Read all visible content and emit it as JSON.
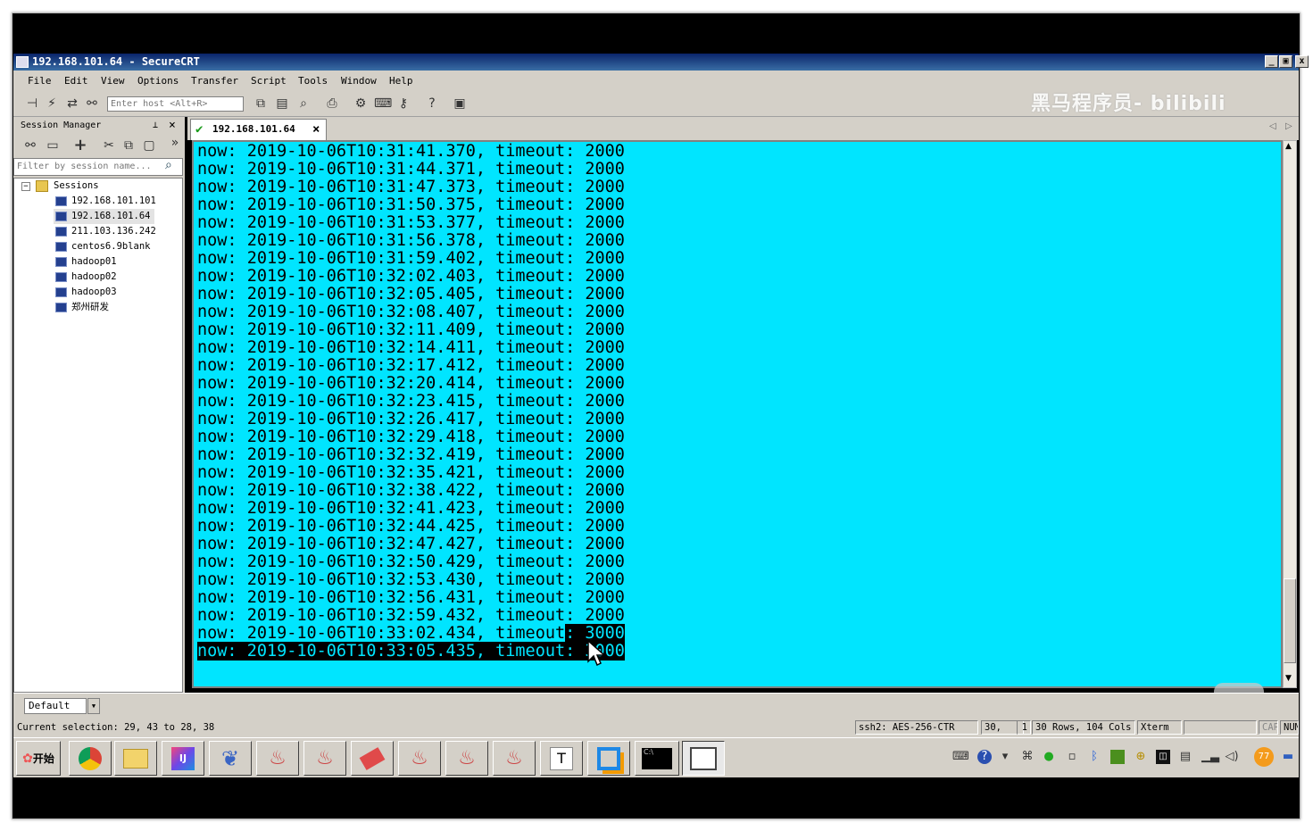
{
  "window": {
    "title": "192.168.101.64 - SecureCRT",
    "controls": [
      "_",
      "▣",
      "x"
    ]
  },
  "menu": [
    "File",
    "Edit",
    "View",
    "Options",
    "Transfer",
    "Script",
    "Tools",
    "Window",
    "Help"
  ],
  "toolbar": {
    "host_placeholder": "Enter host <Alt+R>",
    "watermark": "黑马程序员- bilibili"
  },
  "session_manager": {
    "title": "Session Manager",
    "filter_placeholder": "Filter by session name...",
    "root": "Sessions",
    "sessions": [
      "192.168.101.101",
      "192.168.101.64",
      "211.103.136.242",
      "centos6.9blank",
      "hadoop01",
      "hadoop02",
      "hadoop03",
      "郑州研发"
    ],
    "selected": "192.168.101.64"
  },
  "tab": {
    "label": "192.168.101.64",
    "status_icon": "check-icon"
  },
  "terminal": {
    "background": "#00e5ff",
    "lines": [
      "now: 2019-10-06T10:31:41.370, timeout: 2000",
      "now: 2019-10-06T10:31:44.371, timeout: 2000",
      "now: 2019-10-06T10:31:47.373, timeout: 2000",
      "now: 2019-10-06T10:31:50.375, timeout: 2000",
      "now: 2019-10-06T10:31:53.377, timeout: 2000",
      "now: 2019-10-06T10:31:56.378, timeout: 2000",
      "now: 2019-10-06T10:31:59.402, timeout: 2000",
      "now: 2019-10-06T10:32:02.403, timeout: 2000",
      "now: 2019-10-06T10:32:05.405, timeout: 2000",
      "now: 2019-10-06T10:32:08.407, timeout: 2000",
      "now: 2019-10-06T10:32:11.409, timeout: 2000",
      "now: 2019-10-06T10:32:14.411, timeout: 2000",
      "now: 2019-10-06T10:32:17.412, timeout: 2000",
      "now: 2019-10-06T10:32:20.414, timeout: 2000",
      "now: 2019-10-06T10:32:23.415, timeout: 2000",
      "now: 2019-10-06T10:32:26.417, timeout: 2000",
      "now: 2019-10-06T10:32:29.418, timeout: 2000",
      "now: 2019-10-06T10:32:32.419, timeout: 2000",
      "now: 2019-10-06T10:32:35.421, timeout: 2000",
      "now: 2019-10-06T10:32:38.422, timeout: 2000",
      "now: 2019-10-06T10:32:41.423, timeout: 2000",
      "now: 2019-10-06T10:32:44.425, timeout: 2000",
      "now: 2019-10-06T10:32:47.427, timeout: 2000",
      "now: 2019-10-06T10:32:50.429, timeout: 2000",
      "now: 2019-10-06T10:32:53.430, timeout: 2000",
      "now: 2019-10-06T10:32:56.431, timeout: 2000",
      "now: 2019-10-06T10:32:59.432, timeout: 2000",
      "now: 2019-10-06T10:33:02.434, timeout: 3000",
      "now: 2019-10-06T10:33:05.435, timeout: 3000"
    ]
  },
  "lower_bar": {
    "button_bar": "Default"
  },
  "status": {
    "selection": "Current selection: 29, 43 to 28, 38",
    "cipher": "ssh2: AES-256-CTR",
    "row": "30,",
    "col": "1",
    "size": "30 Rows, 104 Cols",
    "term": "Xterm",
    "cap": "CAP",
    "num": "NUM"
  },
  "taskbar": {
    "start_label": "开始",
    "apps": [
      "chrome-icon",
      "folder-icon",
      "intellij-icon",
      "sourcetree-icon",
      "java-icon",
      "java-icon",
      "eraser-icon",
      "java-icon",
      "java-icon",
      "java-icon",
      "text-icon",
      "vmware-icon",
      "cmd-icon",
      "securecrt-icon"
    ],
    "tray_badge": "77"
  }
}
